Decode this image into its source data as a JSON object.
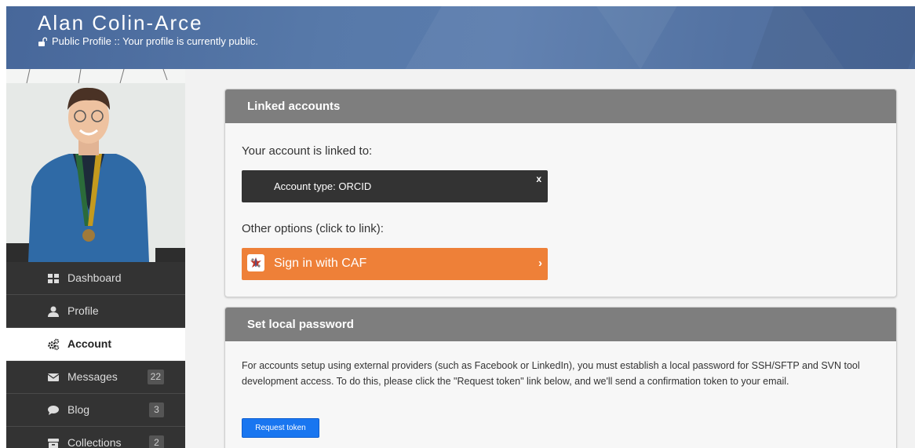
{
  "header": {
    "user_name": "Alan Colin-Arce",
    "privacy_text": "Public Profile :: Your profile is currently public."
  },
  "sidebar": {
    "items": [
      {
        "label": "Dashboard",
        "icon": "dashboard-icon"
      },
      {
        "label": "Profile",
        "icon": "user-icon"
      },
      {
        "label": "Account",
        "icon": "cogs-icon",
        "active": true
      },
      {
        "label": "Messages",
        "icon": "envelope-icon",
        "badge": "22"
      },
      {
        "label": "Blog",
        "icon": "comment-icon",
        "badge": "3"
      },
      {
        "label": "Collections",
        "icon": "archive-icon",
        "badge": "2"
      }
    ]
  },
  "linked_accounts": {
    "title": "Linked accounts",
    "linked_intro": "Your account is linked to:",
    "account_label": "Account type: ORCID",
    "close_label": "x",
    "other_options": "Other options (click to link):",
    "caf_label": "Sign in with CAF",
    "caf_chevron": "›"
  },
  "local_password": {
    "title": "Set local password",
    "description": "For accounts setup using external providers (such as Facebook or LinkedIn), you must establish a local password for SSH/SFTP and SVN tool development access. To do this, please click the \"Request token\" link below, and we'll send a confirmation token to your email.",
    "button_label": "Request token"
  },
  "colors": {
    "header_blue": "#5275a6",
    "sidebar_dark": "#333333",
    "panel_header_gray": "#7e7e7e",
    "caf_orange": "#ee8038",
    "primary_blue": "#1976f0"
  }
}
